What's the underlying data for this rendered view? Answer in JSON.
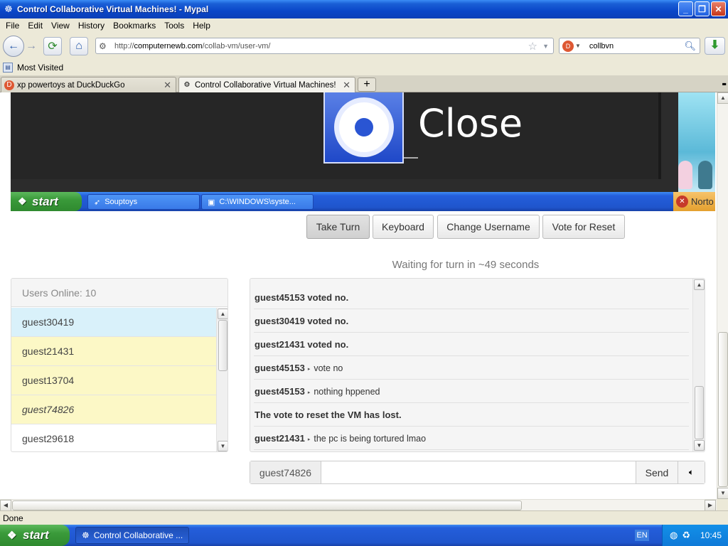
{
  "window": {
    "title": "Control Collaborative Virtual Machines! - Mypal",
    "buttons": [
      "_",
      "❐",
      "✕"
    ]
  },
  "menu": [
    "File",
    "Edit",
    "View",
    "History",
    "Bookmarks",
    "Tools",
    "Help"
  ],
  "nav": {
    "url_prefix": "http://",
    "url_domain": "computernewb.com",
    "url_path": "/collab-vm/user-vm/",
    "search_value": "collbvn"
  },
  "bookmarks": {
    "most_visited": "Most Visited"
  },
  "tabs": [
    {
      "label": "xp powertoys at DuckDuckGo"
    },
    {
      "label": "Control Collaborative Virtual Machines!"
    }
  ],
  "vm": {
    "dialog_text": "Close",
    "start_label": "start",
    "taskbar_items": [
      "Souptoys",
      "C:\\WINDOWS\\syste..."
    ],
    "tray_text": "Norto"
  },
  "controls": {
    "take_turn": "Take Turn",
    "keyboard": "Keyboard",
    "change_username": "Change Username",
    "vote_reset": "Vote for Reset",
    "waiting": "Waiting for turn in ~49 seconds"
  },
  "users": {
    "header": "Users Online: 10",
    "list": [
      "guest30419",
      "guest21431",
      "guest13704",
      "guest74826",
      "guest29618"
    ]
  },
  "chat": {
    "messages": [
      {
        "system": "guest45153 voted no."
      },
      {
        "system": "guest30419 voted no."
      },
      {
        "system": "guest21431 voted no."
      },
      {
        "user": "guest45153",
        "text": "vote no"
      },
      {
        "user": "guest45153",
        "text": "nothing hppened"
      },
      {
        "system": "The vote to reset the VM has lost."
      },
      {
        "user": "guest21431",
        "text": "the pc is being tortured lmao"
      }
    ],
    "username": "guest74826",
    "input_value": "",
    "send": "Send",
    "sound_icon": "speaker-icon"
  },
  "status": "Done",
  "taskbar": {
    "start": "start",
    "task": "Control Collaborative ...",
    "lang": "EN",
    "clock": "10:45"
  }
}
